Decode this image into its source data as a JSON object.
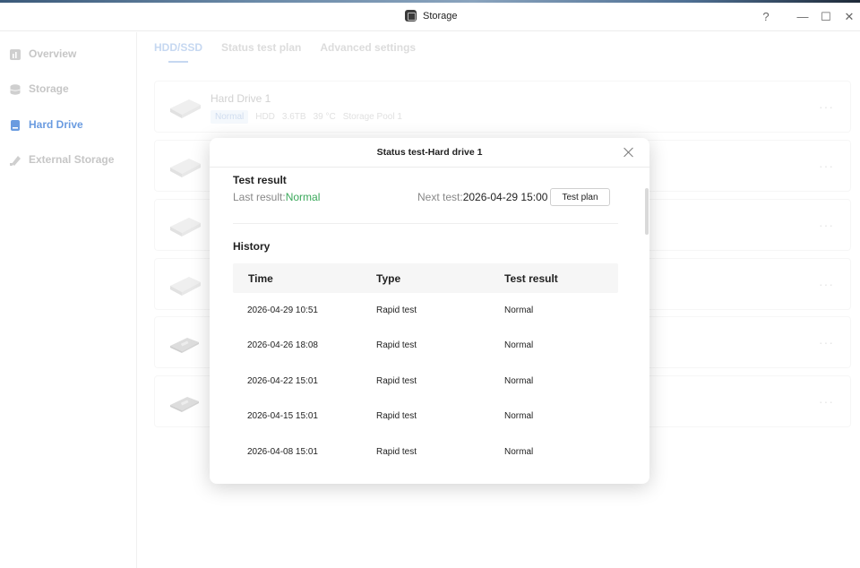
{
  "window": {
    "title": "Storage",
    "controls": {
      "help": "?",
      "minimize": "—",
      "maximize": "☐",
      "close": "✕"
    }
  },
  "sidebar": {
    "items": [
      {
        "label": "Overview",
        "icon": "overview-icon",
        "active": false
      },
      {
        "label": "Storage",
        "icon": "storage-icon",
        "active": false
      },
      {
        "label": "Hard Drive",
        "icon": "hard-drive-icon",
        "active": true
      },
      {
        "label": "External Storage",
        "icon": "external-storage-icon",
        "active": false
      }
    ]
  },
  "tabs": [
    {
      "label": "HDD/SSD",
      "active": true
    },
    {
      "label": "Status test plan",
      "active": false
    },
    {
      "label": "Advanced settings",
      "active": false
    }
  ],
  "drives": [
    {
      "name": "Hard Drive 1",
      "status": "Normal",
      "type": "HDD",
      "capacity": "3.6TB",
      "temp": "39 °C",
      "pool": "Storage Pool 1"
    }
  ],
  "more_label": "···",
  "modal": {
    "title": "Status test-Hard drive 1",
    "test_result": {
      "heading": "Test result",
      "last_label": "Last result:",
      "last_value": "Normal",
      "next_label": "Next test:",
      "next_value": "2026-04-29 15:00",
      "plan_button": "Test plan"
    },
    "history": {
      "heading": "History",
      "columns": [
        "Time",
        "Type",
        "Test result"
      ],
      "rows": [
        [
          "2026-04-29 10:51",
          "Rapid test",
          "Normal"
        ],
        [
          "2026-04-26 18:08",
          "Rapid test",
          "Normal"
        ],
        [
          "2026-04-22 15:01",
          "Rapid test",
          "Normal"
        ],
        [
          "2026-04-15 15:01",
          "Rapid test",
          "Normal"
        ],
        [
          "2026-04-08 15:01",
          "Rapid test",
          "Normal"
        ]
      ]
    }
  },
  "colors": {
    "accent": "#6a9be0",
    "success": "#3aa85a"
  }
}
